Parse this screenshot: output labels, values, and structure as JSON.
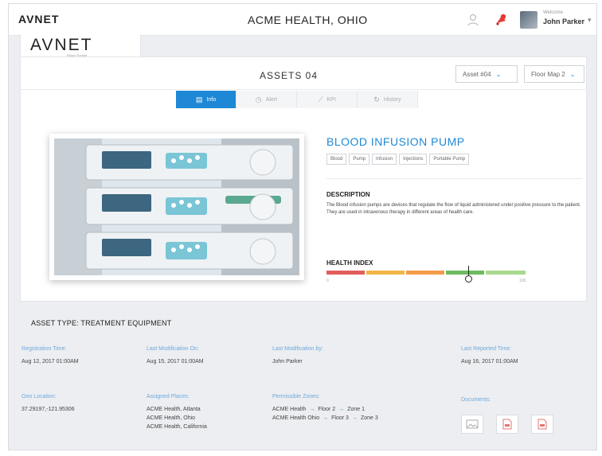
{
  "header": {
    "logo": "AVNET",
    "title": "ACME HEALTH, OHIO",
    "welcome": "Welcome",
    "user": "John Parker"
  },
  "logo_tab": {
    "logo": "AVNET",
    "sub": "Reach Further"
  },
  "page": {
    "title": "ASSETS 04",
    "asset_select": "Asset #04",
    "floor_select": "Floor Map 2"
  },
  "tabs": [
    {
      "label": "Info",
      "icon": "info-card-icon",
      "active": true
    },
    {
      "label": "Alert",
      "icon": "alert-clock-icon",
      "active": false
    },
    {
      "label": "KPI",
      "icon": "trend-chart-icon",
      "active": false
    },
    {
      "label": "History",
      "icon": "history-icon",
      "active": false
    }
  ],
  "product": {
    "name": "BLOOD INFUSION PUMP",
    "tags": [
      "Blood",
      "Pump",
      "Infusion",
      "Injections",
      "Portable Pump"
    ],
    "description_title": "DESCRIPTION",
    "description": "The Blood infusion pumps are devices that regulate the flow of liquid administered under positive pressure to the patient. They are used in intravenous therapy in different areas of health care.",
    "health_title": "HEALTH INDEX",
    "health_min": "0",
    "health_max": "100",
    "health_value": 71
  },
  "details": {
    "asset_type": "ASSET TYPE: TREATMENT EQUIPMENT",
    "registration_label": "Registration Time:",
    "registration_value": "Aug 12, 2017  01:00AM",
    "last_mod_on_label": "Last Modification On:",
    "last_mod_on_value": "Aug 15, 2017  01:00AM",
    "last_mod_by_label": "Last Modification by:",
    "last_mod_by_value": "John Parker",
    "last_reported_label": "Last Reported Time:",
    "last_reported_value": "Aug 16, 2017  01:00AM",
    "geo_label": "Geo Location:",
    "geo_value": "37.29197,-121.95306",
    "places_label": "Assigned Places:",
    "places": [
      "ACME Health, Atlanta",
      "ACME Health, Ohio",
      "ACME Health, California"
    ],
    "zones_label": "Permissible Zones:",
    "zones": [
      {
        "a": "ACME Health",
        "b": "Floor 2",
        "c": "Zone 1"
      },
      {
        "a": "ACME Health Ohio",
        "b": "Floor 3",
        "c": "Zone 3"
      }
    ],
    "documents_label": "Documents:"
  },
  "colors": {
    "accent": "#1e88d6",
    "label_blue": "#6fa8dc",
    "notify_red": "#e53935"
  }
}
